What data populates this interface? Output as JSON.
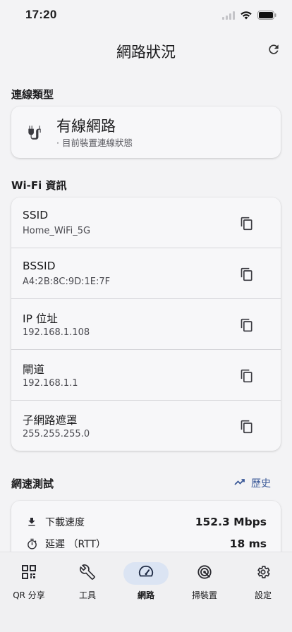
{
  "status_bar": {
    "time": "17:20"
  },
  "header": {
    "title": "網路狀況"
  },
  "connection": {
    "section_title": "連線類型",
    "type": "有線網路",
    "subtitle": "· 目前裝置連線狀態"
  },
  "wifi": {
    "section_title": "Wi-Fi 資訊",
    "rows": [
      {
        "label": "SSID",
        "value": "Home_WiFi_5G"
      },
      {
        "label": "BSSID",
        "value": "A4:2B:8C:9D:1E:7F"
      },
      {
        "label": "IP 位址",
        "value": "192.168.1.108"
      },
      {
        "label": "閘道",
        "value": "192.168.1.1"
      },
      {
        "label": "子網路遮罩",
        "value": "255.255.255.0"
      }
    ]
  },
  "speed_test": {
    "section_title": "網速測試",
    "history_label": "歷史",
    "rows": [
      {
        "icon": "download-icon",
        "label": "下載速度",
        "value": "152.3 Mbps"
      },
      {
        "icon": "timer-icon",
        "label": "延遲 （RTT）",
        "value": "18 ms"
      }
    ]
  },
  "nav": {
    "items": [
      {
        "label": "QR 分享",
        "icon": "qr-code-icon",
        "active": false
      },
      {
        "label": "工具",
        "icon": "wrench-icon",
        "active": false
      },
      {
        "label": "網路",
        "icon": "speedometer-icon",
        "active": true
      },
      {
        "label": "掃裝置",
        "icon": "radar-icon",
        "active": false
      },
      {
        "label": "設定",
        "icon": "gear-icon",
        "active": false
      }
    ]
  },
  "colors": {
    "accent": "#3b5998",
    "active_pill": "#dbe4f3",
    "background": "#f3f3f5"
  }
}
